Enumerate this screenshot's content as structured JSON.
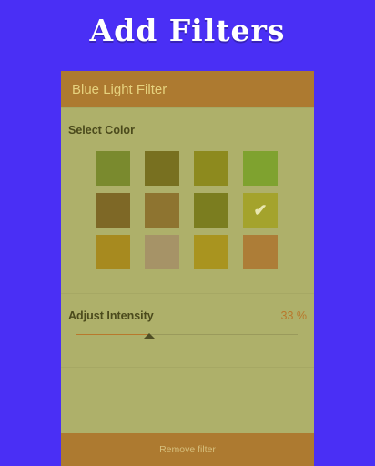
{
  "banner": {
    "title": "Add Filters"
  },
  "app_bar": {
    "title": "Blue Light Filter"
  },
  "color_section": {
    "label": "Select Color",
    "swatches": [
      {
        "color": "#7a8a2e",
        "selected": false
      },
      {
        "color": "#787020",
        "selected": false
      },
      {
        "color": "#8d8a1e",
        "selected": false
      },
      {
        "color": "#7fa22f",
        "selected": false
      },
      {
        "color": "#7e6826",
        "selected": false
      },
      {
        "color": "#8e7430",
        "selected": false
      },
      {
        "color": "#7b7d1f",
        "selected": false
      },
      {
        "color": "#a4a32c",
        "selected": true,
        "icon": "checkmark-icon"
      },
      {
        "color": "#a78a1f",
        "selected": false
      },
      {
        "color": "#a69367",
        "selected": false
      },
      {
        "color": "#a9941f",
        "selected": false
      },
      {
        "color": "#ad7d37",
        "selected": false
      }
    ]
  },
  "intensity": {
    "label": "Adjust Intensity",
    "value_text": "33 %",
    "value": 0.33
  },
  "bottom_bar": {
    "remove_label": "Remove filter"
  },
  "colors": {
    "background": "#4a2ff5",
    "overlay": "#aeb06a",
    "accent": "#ad7a30"
  }
}
